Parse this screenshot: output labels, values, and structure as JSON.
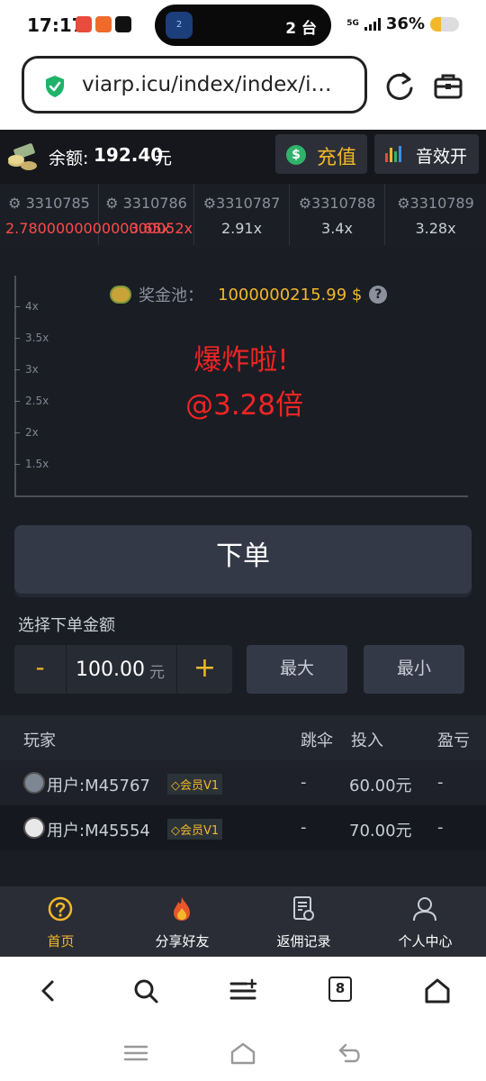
{
  "status_bar": {
    "time": "17:17",
    "island_badge": "2",
    "island_text": "2 台",
    "network": "5G",
    "battery_level": 0.36,
    "battery": "36%"
  },
  "browser": {
    "url": "viarp.icu/index/index/i…",
    "tab_count": "8"
  },
  "header": {
    "balance_label": "余额:",
    "balance_value": "192.40",
    "balance_unit": "元",
    "recharge_icon": "dollar-coin-icon",
    "recharge_label": "充值",
    "sound_label": "音效开"
  },
  "history": [
    {
      "id": "3310785",
      "multiplier": "2.780000000000000052x"
    },
    {
      "id": "3310786",
      "multiplier": "3.65x"
    },
    {
      "id": "3310787",
      "multiplier": "2.91x"
    },
    {
      "id": "3310788",
      "multiplier": "3.4x"
    },
    {
      "id": "3310789",
      "multiplier": "3.28x"
    }
  ],
  "chart": {
    "y_ticks": [
      "4x",
      "3.5x",
      "3x",
      "2.5x",
      "2x",
      "1.5x"
    ],
    "pool_label": "奖金池：",
    "pool_value": "1000000215.99 $",
    "pool_help": "?",
    "crash_title": "爆炸啦!",
    "crash_value": "@3.28倍"
  },
  "order": {
    "place_label": "下单",
    "amount_label": "选择下单金额",
    "minus": "-",
    "plus": "+",
    "amount_value": "100.00",
    "amount_unit": "元",
    "max_label": "最大",
    "min_label": "最小"
  },
  "table": {
    "headers": {
      "player": "玩家",
      "jump": "跳伞",
      "bet": "投入",
      "profit": "盈亏"
    },
    "rows": [
      {
        "name": "用户:M45767",
        "vip": "会员V1",
        "jump": "-",
        "bet": "60.00元",
        "profit": "-"
      },
      {
        "name": "用户:M45554",
        "vip": "会员V1",
        "jump": "-",
        "bet": "70.00元",
        "profit": "-"
      }
    ]
  },
  "nav": {
    "items": [
      {
        "label": "首页",
        "icon": "help-circle-icon",
        "active": true
      },
      {
        "label": "分享好友",
        "icon": "flame-icon",
        "active": false
      },
      {
        "label": "返佣记录",
        "icon": "document-icon",
        "active": false
      },
      {
        "label": "个人中心",
        "icon": "user-icon",
        "active": false
      }
    ]
  },
  "colors": {
    "accent": "#f2b82a",
    "danger": "#f22424",
    "background": "#1a1d24"
  }
}
